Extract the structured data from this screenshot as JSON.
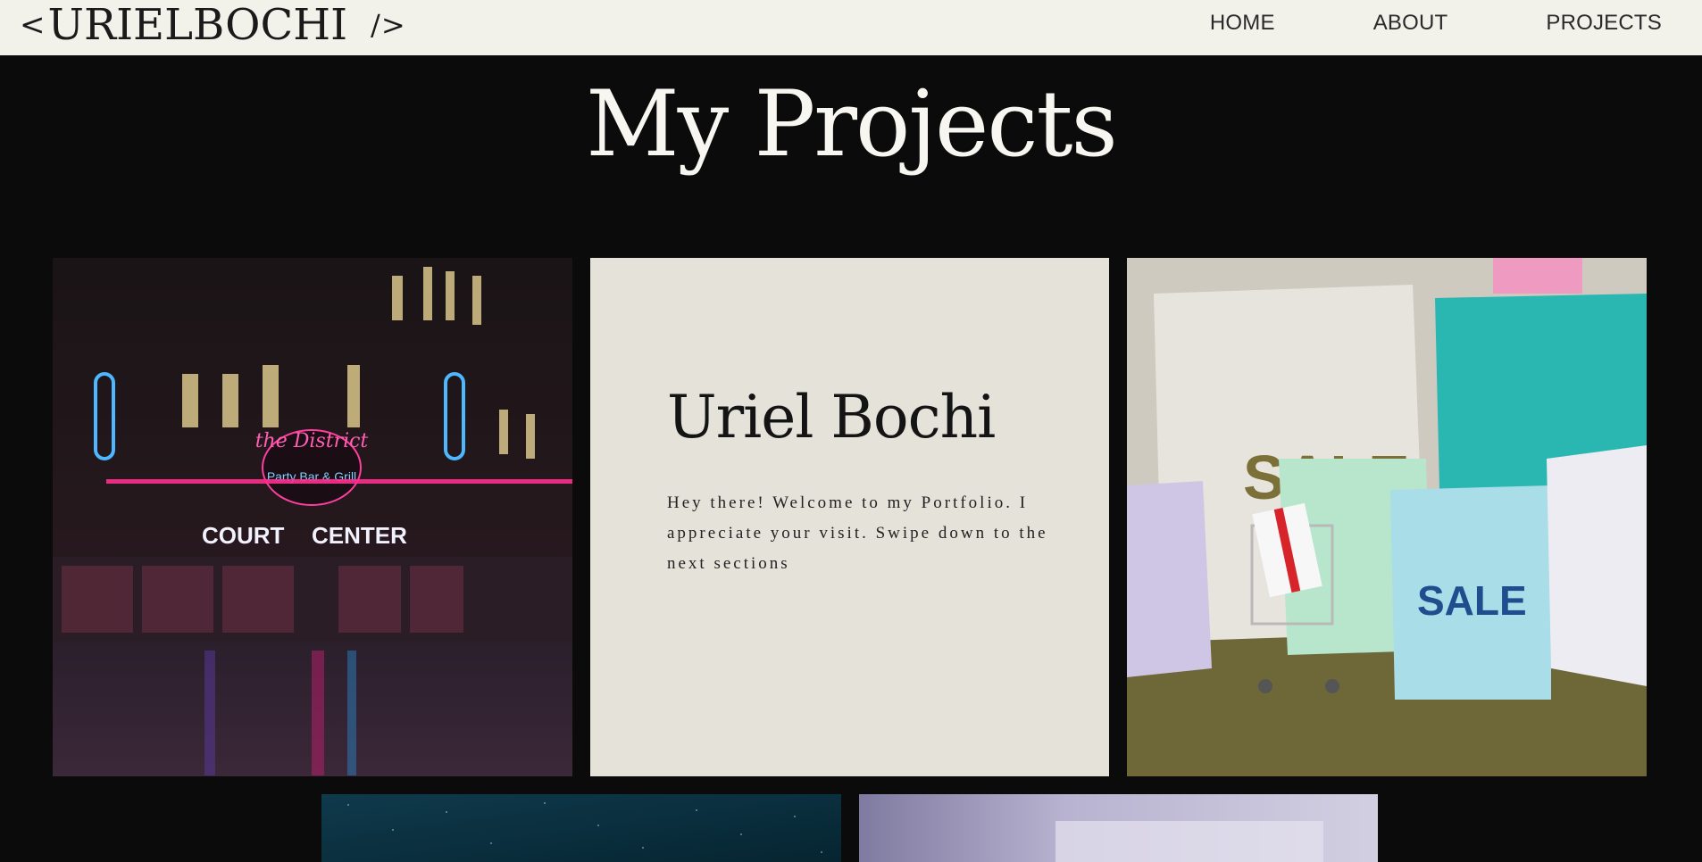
{
  "header": {
    "logo_open": "<",
    "logo_name": "URIELBOCHI",
    "logo_close": "/>",
    "nav": [
      {
        "label": "HOME"
      },
      {
        "label": "ABOUT"
      },
      {
        "label": "PROJECTS"
      }
    ]
  },
  "main": {
    "title": "My Projects",
    "intro": {
      "name": "Uriel Bochi",
      "text": "Hey there! Welcome to my Portfolio. I appreciate your visit. Swipe down to the next sections"
    },
    "tiles": [
      {
        "name": "project-image-night-street",
        "sign_top": "the District",
        "sign_sub": "Party Bar & Grill",
        "sign_court": "COURT",
        "sign_center": "CENTER"
      },
      {
        "name": "project-image-shopping-bags",
        "bag_label": "SALE",
        "bag_label_back": "SALE"
      },
      {
        "name": "project-image-starry-sky"
      },
      {
        "name": "project-image-blurred-screen"
      }
    ]
  },
  "colors": {
    "header_bg": "#f2f1ea",
    "page_bg": "#0b0b0b",
    "intro_bg": "#e5e2da",
    "title_color": "#f7f6f0"
  }
}
